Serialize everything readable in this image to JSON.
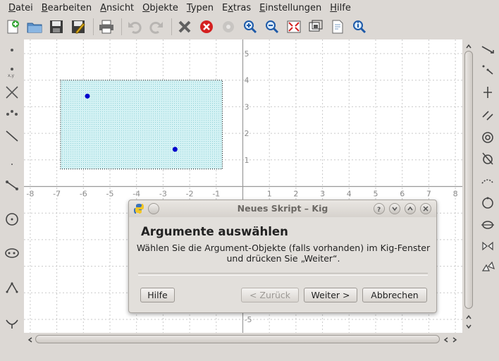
{
  "menu": [
    {
      "label": "Datei",
      "accel": "D",
      "rest": "atei"
    },
    {
      "label": "Bearbeiten",
      "accel": "B",
      "rest": "earbeiten"
    },
    {
      "label": "Ansicht",
      "accel": "A",
      "rest": "nsicht"
    },
    {
      "label": "Objekte",
      "accel": "O",
      "rest": "bjekte"
    },
    {
      "label": "Typen",
      "accel": "T",
      "rest": "ypen"
    },
    {
      "label": "Extras",
      "accel": "x",
      "rest": "tras",
      "pre": "E"
    },
    {
      "label": "Einstellungen",
      "accel": "E",
      "rest": "instellungen"
    },
    {
      "label": "Hilfe",
      "accel": "H",
      "rest": "ilfe"
    }
  ],
  "axis": {
    "x_ticks": [
      "-8",
      "-7",
      "-6",
      "-5",
      "-4",
      "-3",
      "-2",
      "-1",
      "1",
      "2",
      "3",
      "4",
      "5",
      "6",
      "7",
      "8"
    ],
    "y_ticks": [
      "5",
      "4",
      "3",
      "2",
      "1",
      "-5"
    ]
  },
  "dialog": {
    "title": "Neues Skript – Kig",
    "heading": "Argumente auswählen",
    "desc_line1": "Wählen Sie die Argument-Objekte (falls vorhanden) im Kig-Fenster",
    "desc_line2": "und drücken Sie „Weiter“.",
    "buttons": {
      "help": "Hilfe",
      "back": "< Zurück",
      "next": "Weiter >",
      "cancel": "Abbrechen"
    }
  },
  "colors": {
    "selection_fill": "#d4f2f4",
    "point": "#0000cc",
    "grid": "#c9c9c9",
    "axis": "#9a9a9a"
  },
  "icons": {
    "toolbar": [
      "new-document-icon",
      "open-folder-icon",
      "save-icon",
      "save-as-icon",
      "print-icon",
      "undo-icon",
      "redo-icon",
      "delete-icon",
      "cancel-construction-icon",
      "settings-icon",
      "zoom-in-icon",
      "zoom-out-icon",
      "fullscreen-icon",
      "zoom-area-icon",
      "document-icon",
      "info-zoom-icon"
    ]
  }
}
